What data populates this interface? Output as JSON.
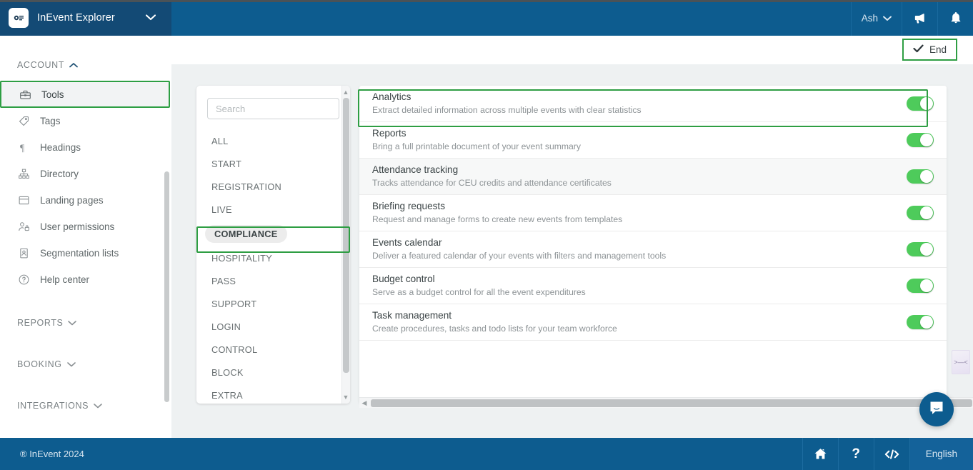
{
  "topbar": {
    "brand_title": "InEvent Explorer",
    "brand_caret": "chevron-down",
    "user_name": "Ash",
    "announce_icon": "megaphone",
    "bell_icon": "bell"
  },
  "content_header": {
    "end_label": "End",
    "end_icon": "check"
  },
  "sidebar": {
    "sections": [
      {
        "label": "ACCOUNT",
        "caret": "up"
      },
      {
        "label": "REPORTS",
        "caret": "down"
      },
      {
        "label": "BOOKING",
        "caret": "down"
      },
      {
        "label": "INTEGRATIONS",
        "caret": "down"
      }
    ],
    "items": [
      {
        "label": "Tools",
        "icon": "toolbox-icon",
        "active": true
      },
      {
        "label": "Tags",
        "icon": "tag-icon",
        "active": false
      },
      {
        "label": "Headings",
        "icon": "paragraph-icon",
        "active": false
      },
      {
        "label": "Directory",
        "icon": "sitemap-icon",
        "active": false
      },
      {
        "label": "Landing pages",
        "icon": "window-icon",
        "active": false
      },
      {
        "label": "User permissions",
        "icon": "user-lock-icon",
        "active": false
      },
      {
        "label": "Segmentation lists",
        "icon": "id-card-icon",
        "active": false
      },
      {
        "label": "Help center",
        "icon": "question-circle-icon",
        "active": false
      }
    ]
  },
  "categories": {
    "search_placeholder": "Search",
    "search_value": "",
    "selected": "COMPLIANCE",
    "items": [
      "ALL",
      "START",
      "REGISTRATION",
      "LIVE",
      "COMPLIANCE",
      "HOSPITALITY",
      "PASS",
      "SUPPORT",
      "LOGIN",
      "CONTROL",
      "BLOCK",
      "EXTRA"
    ]
  },
  "tools": {
    "selected_index": 0,
    "rows": [
      {
        "title": "Analytics",
        "desc": "Extract detailed information across multiple events with clear statistics",
        "enabled": true
      },
      {
        "title": "Reports",
        "desc": "Bring a full printable document of your event summary",
        "enabled": true
      },
      {
        "title": "Attendance tracking",
        "desc": "Tracks attendance for CEU credits and attendance certificates",
        "enabled": true
      },
      {
        "title": "Briefing requests",
        "desc": "Request and manage forms to create new events from templates",
        "enabled": true
      },
      {
        "title": "Events calendar",
        "desc": "Deliver a featured calendar of your events with filters and management tools",
        "enabled": true
      },
      {
        "title": "Budget control",
        "desc": "Serve as a budget control for all the event expenditures",
        "enabled": true
      },
      {
        "title": "Task management",
        "desc": "Create procedures, tasks and todo lists for your team workforce",
        "enabled": true
      }
    ]
  },
  "footer": {
    "copyright": "® InEvent 2024",
    "home_icon": "home-icon",
    "help_icon": "question-icon",
    "code_icon": "code-icon",
    "language": "English"
  },
  "colors": {
    "brand_blue": "#0d5c8f",
    "brand_blue_dark": "#134a75",
    "highlight_green": "#2e9e43",
    "toggle_green": "#4ecb5b",
    "page_bg": "#eef1f2"
  }
}
